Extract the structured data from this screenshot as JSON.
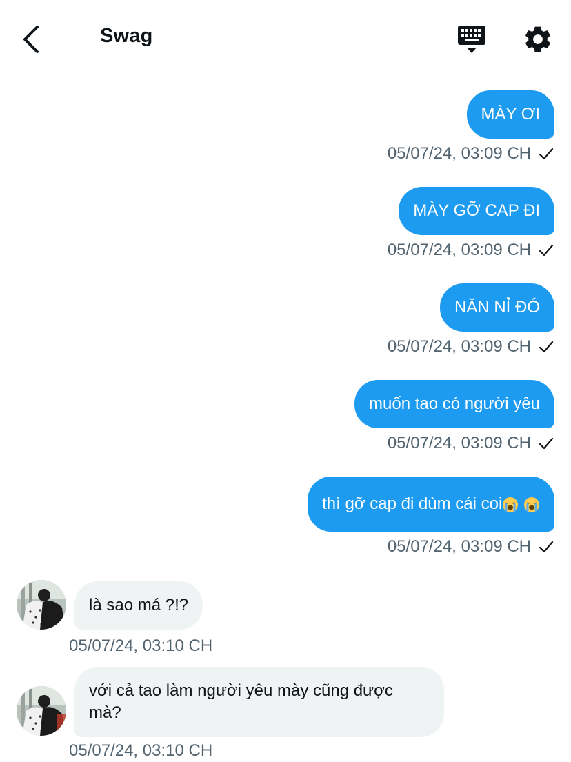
{
  "header": {
    "title": "Swag",
    "back_icon": "chevron-left-icon",
    "keyboard_icon": "keyboard-hide-icon",
    "settings_icon": "gear-icon"
  },
  "colors": {
    "sent_bubble": "#1d9bf0",
    "received_bubble": "#eff3f4",
    "meta_text": "#536471"
  },
  "sent_messages": [
    {
      "text": "MÀY ƠI",
      "time": "05/07/24, 03:09 CH",
      "status": "sent-check"
    },
    {
      "text": "MÀY GỠ CAP ĐI",
      "time": "05/07/24, 03:09 CH",
      "status": "sent-check"
    },
    {
      "text": "NĂN NỈ ĐÓ",
      "time": "05/07/24, 03:09 CH",
      "status": "sent-check"
    },
    {
      "text": "muốn tao có người yêu",
      "time": "05/07/24, 03:09 CH",
      "status": "sent-check"
    },
    {
      "text": "thì gỡ cap đi dùm cái coi",
      "emoji": "loudly-crying-face x2",
      "time": "05/07/24, 03:09 CH",
      "status": "sent-check"
    }
  ],
  "received_messages": [
    {
      "text": "là sao má ?!?",
      "time": "05/07/24, 03:10 CH"
    },
    {
      "text_line1": "với cả tao làm người yêu mày cũng được",
      "text_line2": "mà?",
      "time": "05/07/24, 03:10 CH"
    }
  ]
}
